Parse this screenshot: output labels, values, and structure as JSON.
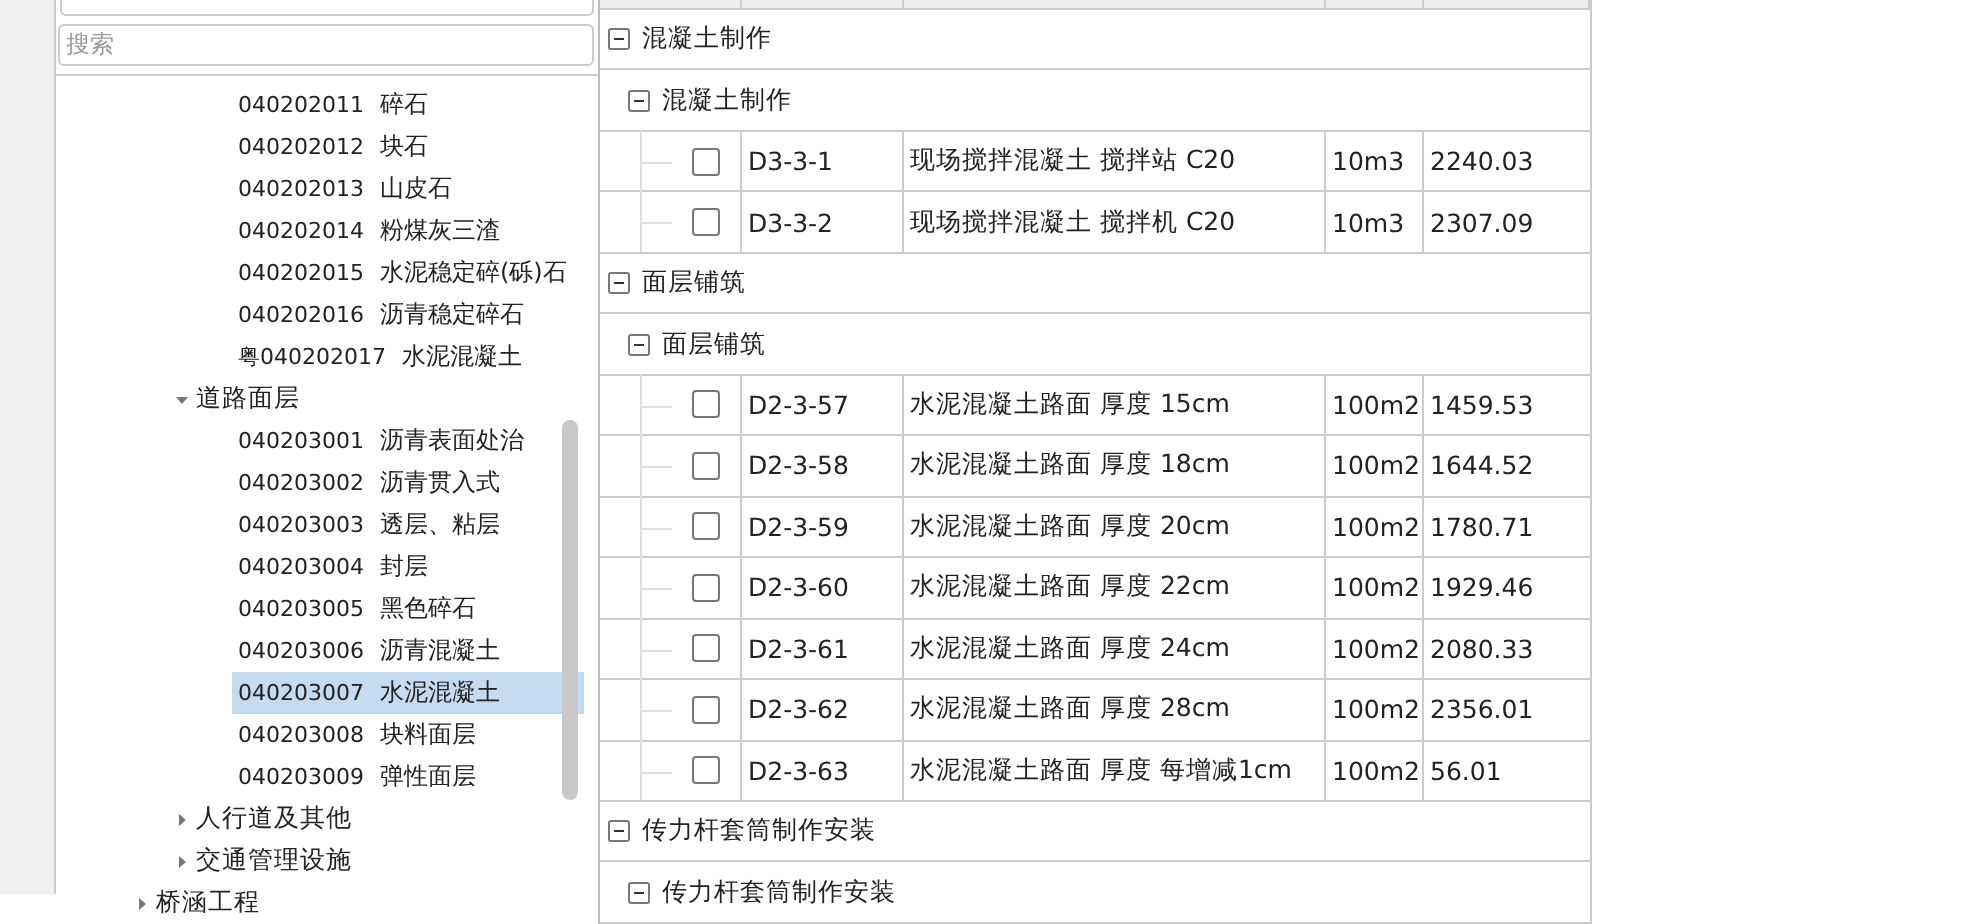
{
  "search": {
    "placeholder": "搜索"
  },
  "tree": [
    {
      "children": [
        {
          "children": [
            {
              "code": "040202011",
              "name": "碎石",
              "selected": false
            },
            {
              "code": "040202012",
              "name": "块石",
              "selected": false
            },
            {
              "code": "040202013",
              "name": "山皮石",
              "selected": false
            },
            {
              "code": "040202014",
              "name": "粉煤灰三渣",
              "selected": false
            },
            {
              "code": "040202015",
              "name": "水泥稳定碎(砾)石",
              "selected": false
            },
            {
              "code": "040202016",
              "name": "沥青稳定碎石",
              "selected": false
            },
            {
              "code": "粤040202017",
              "name": "水泥混凝土",
              "selected": false
            }
          ]
        },
        {
          "label": "道路面层",
          "expanded": true,
          "children": [
            {
              "code": "040203001",
              "name": "沥青表面处治",
              "selected": false
            },
            {
              "code": "040203002",
              "name": "沥青贯入式",
              "selected": false
            },
            {
              "code": "040203003",
              "name": "透层、粘层",
              "selected": false
            },
            {
              "code": "040203004",
              "name": "封层",
              "selected": false
            },
            {
              "code": "040203005",
              "name": "黑色碎石",
              "selected": false
            },
            {
              "code": "040203006",
              "name": "沥青混凝土",
              "selected": false
            },
            {
              "code": "040203007",
              "name": "水泥混凝土",
              "selected": true
            },
            {
              "code": "040203008",
              "name": "块料面层",
              "selected": false
            },
            {
              "code": "040203009",
              "name": "弹性面层",
              "selected": false
            }
          ]
        },
        {
          "label": "人行道及其他",
          "expanded": false
        },
        {
          "label": "交通管理设施",
          "expanded": false
        }
      ]
    },
    {
      "label": "桥涵工程",
      "expanded": false
    }
  ],
  "table": {
    "groups": [
      {
        "title": "混凝土制作",
        "expanded": true,
        "children": [
          {
            "title": "混凝土制作",
            "expanded": true,
            "rows": [
              {
                "checked": false,
                "code": "D3-3-1",
                "name": "现场搅拌混凝土 搅拌站 C20",
                "unit": "10m3",
                "price": "2240.03"
              },
              {
                "checked": false,
                "code": "D3-3-2",
                "name": "现场搅拌混凝土 搅拌机 C20",
                "unit": "10m3",
                "price": "2307.09"
              }
            ]
          }
        ]
      },
      {
        "title": "面层铺筑",
        "expanded": true,
        "children": [
          {
            "title": "面层铺筑",
            "expanded": true,
            "rows": [
              {
                "checked": false,
                "code": "D2-3-57",
                "name": "水泥混凝土路面 厚度 15cm",
                "unit": "100m2",
                "price": "1459.53"
              },
              {
                "checked": false,
                "code": "D2-3-58",
                "name": "水泥混凝土路面 厚度 18cm",
                "unit": "100m2",
                "price": "1644.52"
              },
              {
                "checked": false,
                "code": "D2-3-59",
                "name": "水泥混凝土路面 厚度 20cm",
                "unit": "100m2",
                "price": "1780.71"
              },
              {
                "checked": false,
                "code": "D2-3-60",
                "name": "水泥混凝土路面 厚度 22cm",
                "unit": "100m2",
                "price": "1929.46"
              },
              {
                "checked": false,
                "code": "D2-3-61",
                "name": "水泥混凝土路面 厚度 24cm",
                "unit": "100m2",
                "price": "2080.33"
              },
              {
                "checked": false,
                "code": "D2-3-62",
                "name": "水泥混凝土路面 厚度 28cm",
                "unit": "100m2",
                "price": "2356.01"
              },
              {
                "checked": false,
                "code": "D2-3-63",
                "name": "水泥混凝土路面 厚度 每增减1cm",
                "unit": "100m2",
                "price": "56.01"
              }
            ]
          }
        ]
      },
      {
        "title": "传力杆套筒制作安装",
        "expanded": true,
        "children": [
          {
            "title": "传力杆套筒制作安装",
            "expanded": true
          }
        ]
      }
    ]
  }
}
